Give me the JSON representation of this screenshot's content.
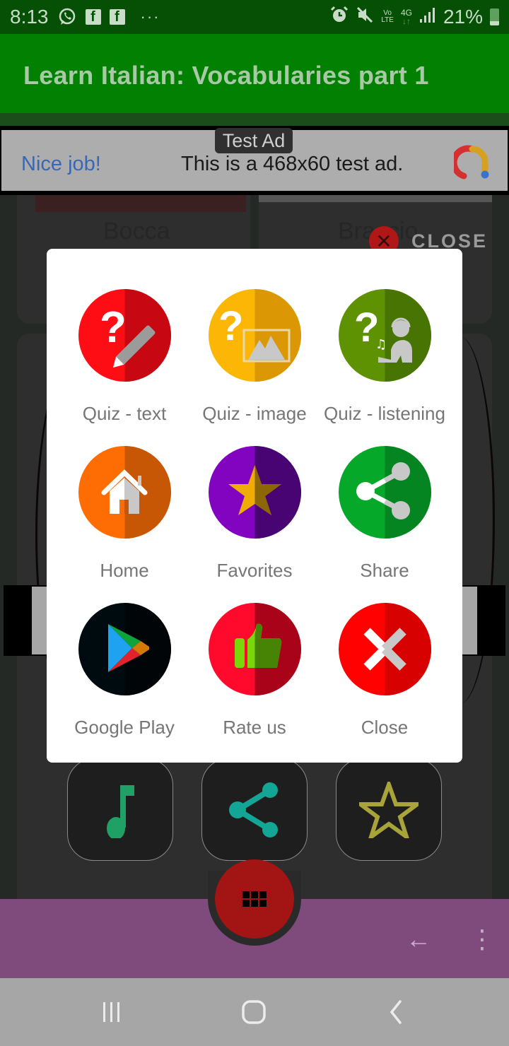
{
  "status_bar": {
    "time": "8:13",
    "left_icons": [
      "whatsapp-icon",
      "facebook-icon",
      "facebook-icon",
      "more-notifications-icon"
    ],
    "more_glyph": "···",
    "right_icons": [
      "alarm-icon",
      "mute-icon",
      "volte-icon",
      "4g-icon",
      "signal-icon"
    ],
    "volte_top": "Vo",
    "volte_bottom": "LTE",
    "network": "4G",
    "battery": "21%"
  },
  "app_bar": {
    "title": "Learn Italian: Vocabularies part 1"
  },
  "ad": {
    "badge": "Test Ad",
    "headline": "Nice job!",
    "text": "This is a 468x60 test ad."
  },
  "background": {
    "card_labels": [
      "Bocca",
      "Braccio"
    ]
  },
  "overlay_close": {
    "label": "CLOSE"
  },
  "dialog": {
    "items": [
      {
        "label": "Quiz - text",
        "icon": "quiz-text-icon",
        "color": "#ff0d15",
        "shade": "#c70711"
      },
      {
        "label": "Quiz - image",
        "icon": "quiz-image-icon",
        "color": "#fcb606",
        "shade": "#dc9705"
      },
      {
        "label": "Quiz - listening",
        "icon": "quiz-listening-icon",
        "color": "#5e9203",
        "shade": "#487403"
      },
      {
        "label": "Home",
        "icon": "home-icon",
        "color": "#fe6d03",
        "shade": "#c75704"
      },
      {
        "label": "Favorites",
        "icon": "star-icon",
        "color": "#8203c0",
        "shade": "#480472"
      },
      {
        "label": "Share",
        "icon": "share-icon",
        "color": "#06a82a",
        "shade": "#048522"
      },
      {
        "label": "Google Play",
        "icon": "google-play-icon",
        "color": "#000b10",
        "shade": "#020507"
      },
      {
        "label": "Rate us",
        "icon": "thumbs-up-icon",
        "color": "#ff0a2c",
        "shade": "#a80318"
      },
      {
        "label": "Close",
        "icon": "close-icon",
        "color": "#ff0101",
        "shade": "#d70101"
      }
    ]
  },
  "action_buttons": [
    {
      "name": "music-note-icon",
      "color": "#1fa065"
    },
    {
      "name": "share-icon",
      "color": "#13a596"
    },
    {
      "name": "star-outline-icon",
      "color": "#a8a43a"
    }
  ],
  "bottom_bar": {
    "fab_icon": "apps-grid-icon",
    "back_glyph": "←",
    "more_glyph": "⋮"
  },
  "nav_bar": {
    "buttons": [
      "recent-apps",
      "home",
      "back"
    ]
  }
}
